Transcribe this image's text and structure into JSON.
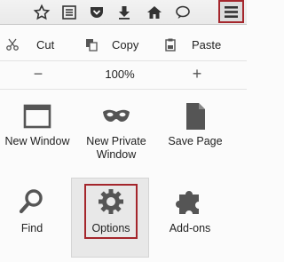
{
  "toolbar": {
    "icons": [
      "star-icon",
      "reading-list-icon",
      "pocket-icon",
      "download-icon",
      "home-icon",
      "chat-icon",
      "menu-icon"
    ]
  },
  "edit": {
    "cut_label": "Cut",
    "copy_label": "Copy",
    "paste_label": "Paste"
  },
  "zoom": {
    "minus_label": "−",
    "value": "100%",
    "plus_label": "+"
  },
  "tiles": {
    "new_window": "New Window",
    "new_private_line1": "New Private",
    "new_private_line2": "Window",
    "save_page": "Save Page",
    "find": "Find",
    "options": "Options",
    "addons": "Add-ons"
  },
  "colors": {
    "highlight": "#a4262c",
    "icon_gray": "#555555"
  }
}
